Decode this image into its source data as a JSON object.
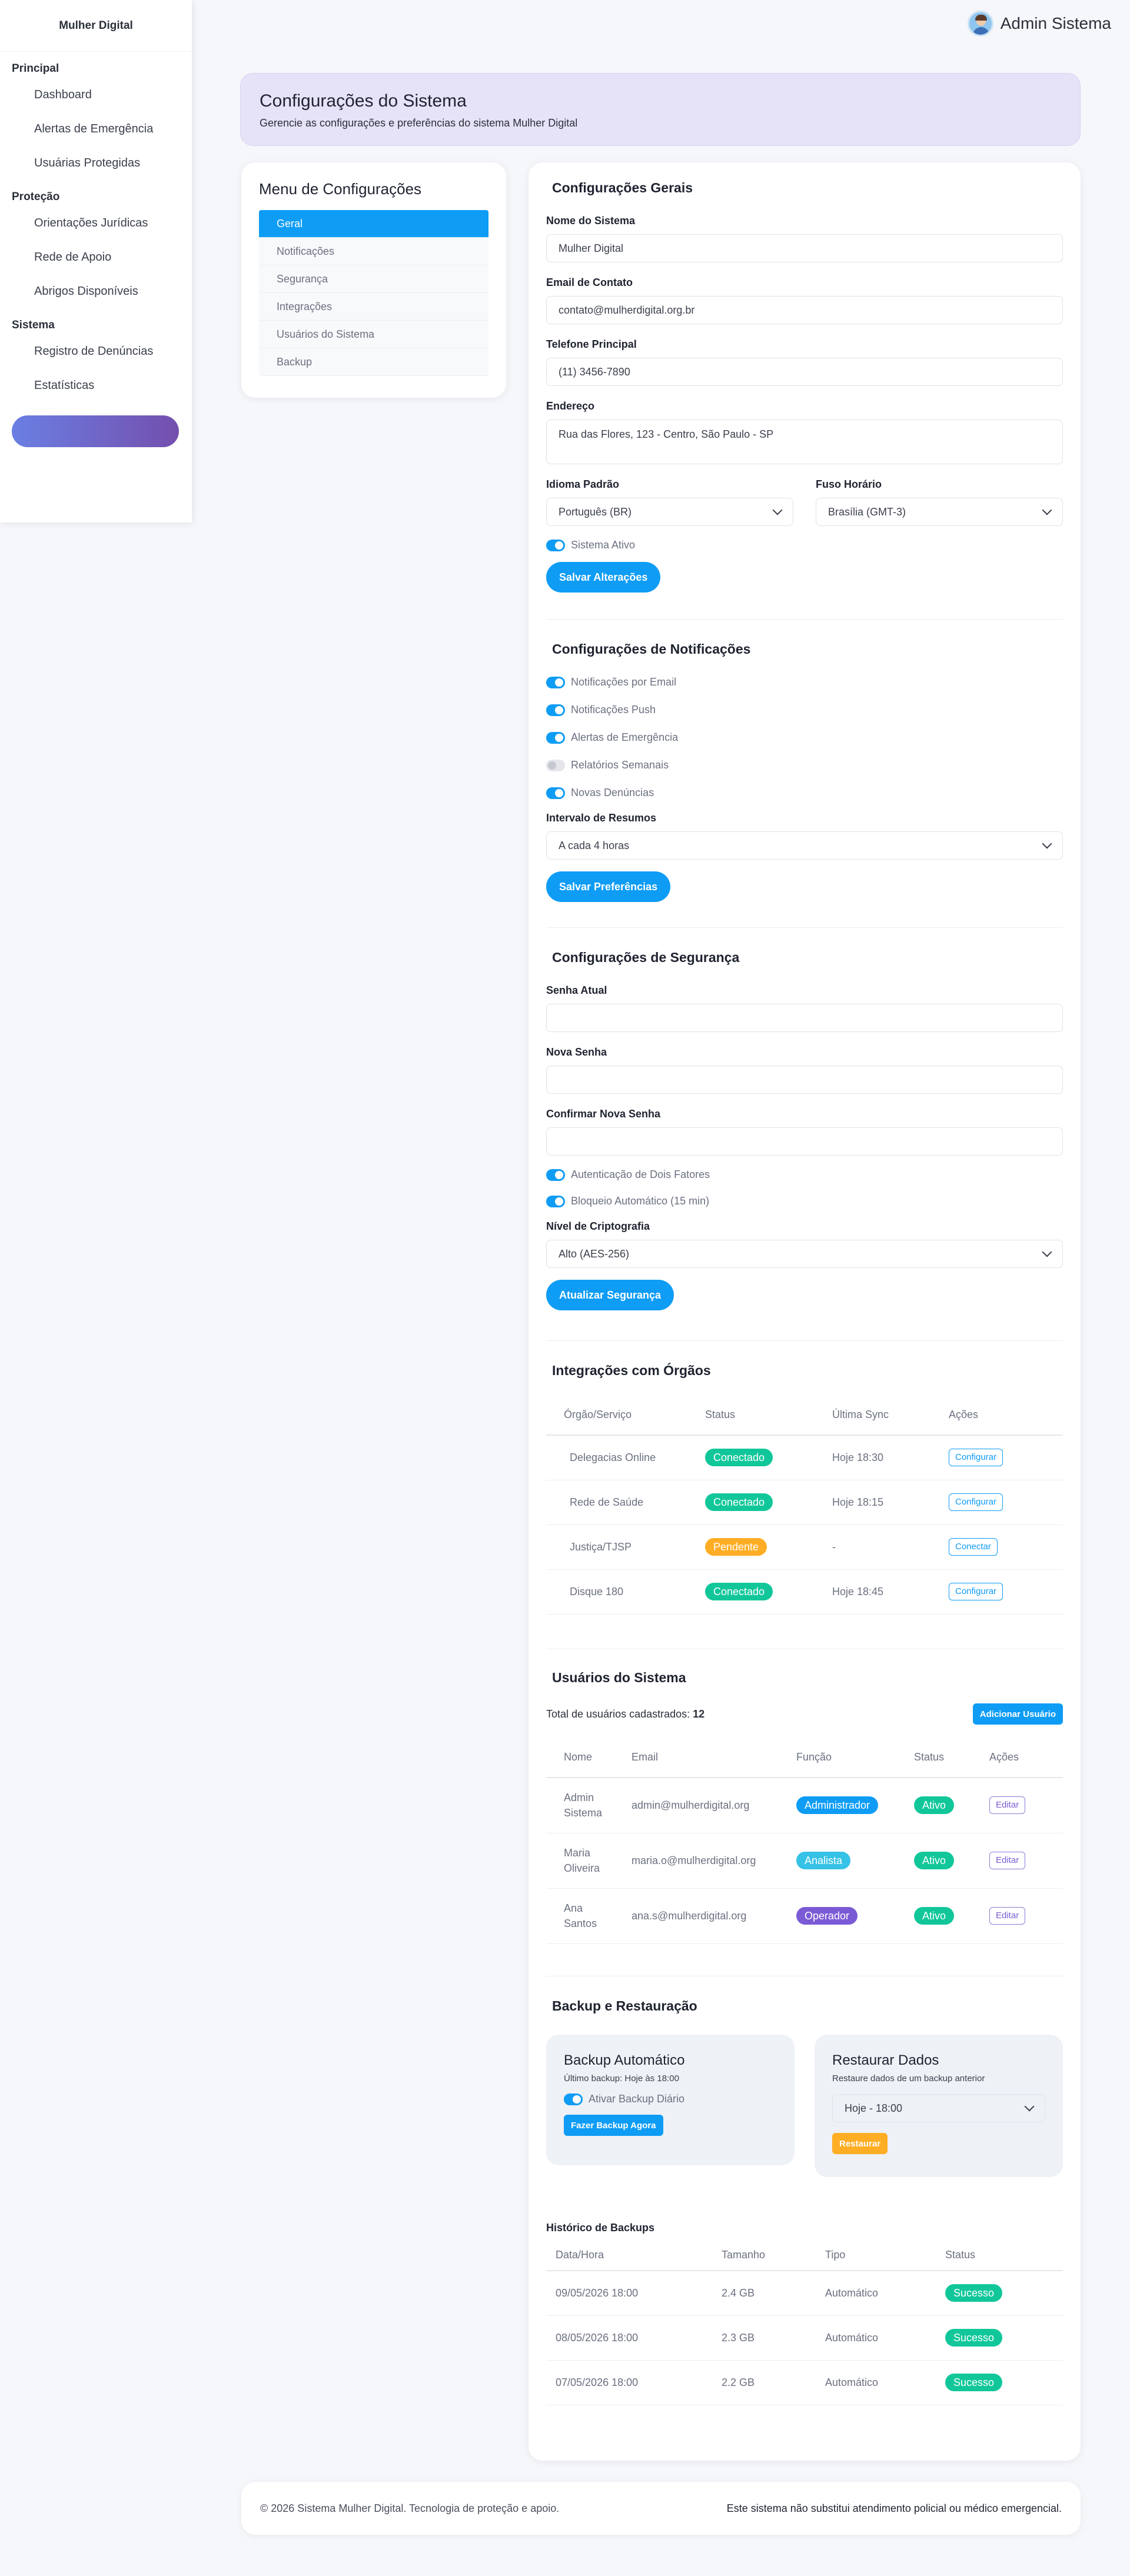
{
  "brand": "Mulher Digital",
  "user": {
    "name": "Admin Sistema"
  },
  "sidebar": {
    "sections": [
      {
        "title": "Principal",
        "items": [
          "Dashboard",
          "Alertas de Emergência",
          "Usuárias Protegidas"
        ]
      },
      {
        "title": "Proteção",
        "items": [
          "Orientações Jurídicas",
          "Rede de Apoio",
          "Abrigos Disponíveis"
        ]
      },
      {
        "title": "Sistema",
        "items": [
          "Registro de Denúncias",
          "Estatísticas"
        ]
      }
    ]
  },
  "banner": {
    "title": "Configurações do Sistema",
    "subtitle": "Gerencie as configurações e preferências do sistema Mulher Digital"
  },
  "menu": {
    "title": "Menu de Configurações",
    "items": [
      "Geral",
      "Notificações",
      "Segurança",
      "Integrações",
      "Usuários do Sistema",
      "Backup"
    ],
    "active": "Geral"
  },
  "general": {
    "title": "Configurações Gerais",
    "system_name_label": "Nome do Sistema",
    "system_name": "Mulher Digital",
    "email_label": "Email de Contato",
    "email": "contato@mulherdigital.org.br",
    "phone_label": "Telefone Principal",
    "phone": "(11) 3456-7890",
    "address_label": "Endereço",
    "address": "Rua das Flores, 123 - Centro, São Paulo - SP",
    "language_label": "Idioma Padrão",
    "language": "Português (BR)",
    "timezone_label": "Fuso Horário",
    "timezone": "Brasília (GMT-3)",
    "active_toggle": "Sistema Ativo",
    "save": "Salvar Alterações"
  },
  "notifications": {
    "title": "Configurações de Notificações",
    "toggles": [
      {
        "label": "Notificações por Email",
        "on": true
      },
      {
        "label": "Notificações Push",
        "on": true
      },
      {
        "label": "Alertas de Emergência",
        "on": true
      },
      {
        "label": "Relatórios Semanais",
        "on": false
      },
      {
        "label": "Novas Denúncias",
        "on": true
      }
    ],
    "interval_label": "Intervalo de Resumos",
    "interval": "A cada 4 horas",
    "save": "Salvar Preferências"
  },
  "security": {
    "title": "Configurações de Segurança",
    "current_label": "Senha Atual",
    "new_label": "Nova Senha",
    "confirm_label": "Confirmar Nova Senha",
    "twofa": "Autenticação de Dois Fatores",
    "autolock": "Bloqueio Automático (15 min)",
    "crypto_label": "Nível de Criptografia",
    "crypto": "Alto (AES-256)",
    "save": "Atualizar Segurança"
  },
  "integrations": {
    "title": "Integrações com Órgãos",
    "headers": [
      "Órgão/Serviço",
      "Status",
      "Última Sync",
      "Ações"
    ],
    "rows": [
      {
        "name": "Delegacias Online",
        "status": "Conectado",
        "sync": "Hoje 18:30",
        "action": "Configurar"
      },
      {
        "name": "Rede de Saúde",
        "status": "Conectado",
        "sync": "Hoje 18:15",
        "action": "Configurar"
      },
      {
        "name": "Justiça/TJSP",
        "status": "Pendente",
        "sync": "-",
        "action": "Conectar"
      },
      {
        "name": "Disque 180",
        "status": "Conectado",
        "sync": "Hoje 18:45",
        "action": "Configurar"
      }
    ]
  },
  "users": {
    "title": "Usuários do Sistema",
    "total_label": "Total de usuários cadastrados:",
    "total": "12",
    "add": "Adicionar Usuário",
    "headers": [
      "Nome",
      "Email",
      "Função",
      "Status",
      "Ações"
    ],
    "rows": [
      {
        "name1": "Admin",
        "name2": "Sistema",
        "email": "admin@mulherdigital.org",
        "role": "Administrador",
        "status": "Ativo",
        "action": "Editar"
      },
      {
        "name1": "Maria",
        "name2": "Oliveira",
        "email": "maria.o@mulherdigital.org",
        "role": "Analista",
        "status": "Ativo",
        "action": "Editar"
      },
      {
        "name1": "Ana",
        "name2": "Santos",
        "email": "ana.s@mulherdigital.org",
        "role": "Operador",
        "status": "Ativo",
        "action": "Editar"
      }
    ]
  },
  "backup": {
    "title": "Backup e Restauração",
    "auto_title": "Backup Automático",
    "auto_sub": "Último backup: Hoje às 18:00",
    "auto_toggle": "Ativar Backup Diário",
    "auto_btn": "Fazer Backup Agora",
    "restore_title": "Restaurar Dados",
    "restore_sub": "Restaure dados de um backup anterior",
    "restore_select": "Hoje - 18:00",
    "restore_btn": "Restaurar",
    "history_title": "Histórico de Backups",
    "headers": [
      "Data/Hora",
      "Tamanho",
      "Tipo",
      "Status"
    ],
    "rows": [
      {
        "date": "09/05/2026 18:00",
        "size": "2.4 GB",
        "type": "Automático",
        "status": "Sucesso"
      },
      {
        "date": "08/05/2026 18:00",
        "size": "2.3 GB",
        "type": "Automático",
        "status": "Sucesso"
      },
      {
        "date": "07/05/2026 18:00",
        "size": "2.2 GB",
        "type": "Automático",
        "status": "Sucesso"
      }
    ]
  },
  "footer": {
    "left": "© 2026 Sistema Mulher Digital. Tecnologia de proteção e apoio.",
    "right": "Este sistema não substitui atendimento policial ou médico emergencial."
  }
}
